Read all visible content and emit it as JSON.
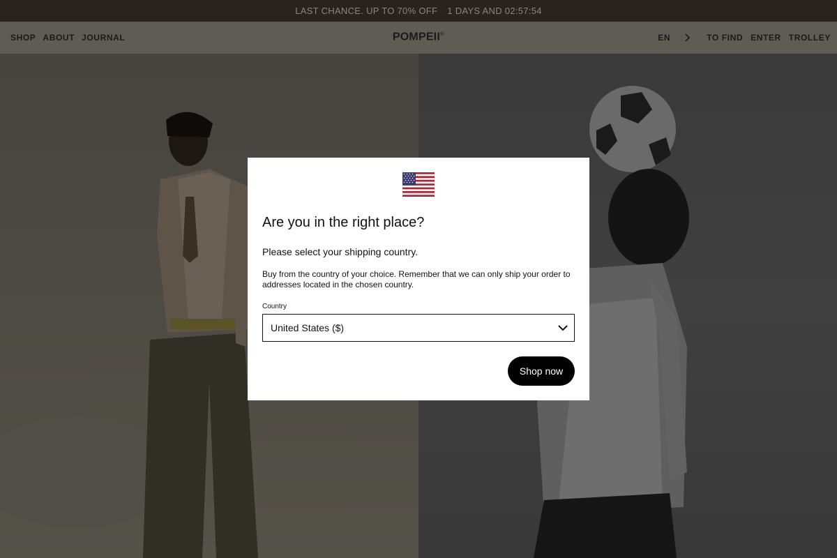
{
  "promo": {
    "text": "LAST CHANCE. UP TO 70% OFF",
    "countdown": "1 DAYS AND 02:57:54"
  },
  "nav": {
    "left": [
      "SHOP",
      "ABOUT",
      "JOURNAL"
    ],
    "logo": "POMPEII",
    "logo_mark": "®",
    "language": "EN",
    "right": [
      "TO FIND",
      "ENTER",
      "TROLLEY"
    ]
  },
  "modal": {
    "flag_icon": "us-flag-icon",
    "title": "Are you in the right place?",
    "subtitle": "Please select your shipping country.",
    "description": "Buy from the country of your choice. Remember that we can only ship your order to addresses located in the chosen country.",
    "country_label": "Country",
    "country_value": "United States ($)",
    "cta": "Shop now"
  },
  "colors": {
    "promo_bg": "#2a221d",
    "nav_bg": "#5f5c55",
    "button_bg": "#000000"
  }
}
